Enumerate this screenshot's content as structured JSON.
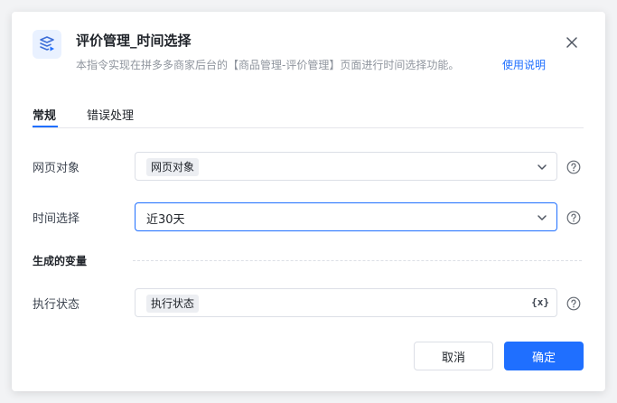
{
  "header": {
    "title": "评价管理_时间选择",
    "description": "本指令实现在拼多多商家后台的【商品管理-评价管理】页面进行时间选择功能。",
    "help_link": "使用说明"
  },
  "tabs": [
    {
      "label": "常规",
      "active": true
    },
    {
      "label": "错误处理",
      "active": false
    }
  ],
  "fields": {
    "page_object": {
      "label": "网页对象",
      "value": "网页对象"
    },
    "time_select": {
      "label": "时间选择",
      "value": "近30天"
    }
  },
  "output_section": {
    "title": "生成的变量",
    "exec_status": {
      "label": "执行状态",
      "value": "执行状态",
      "var_icon": "{x}"
    }
  },
  "footer": {
    "cancel_label": "取消",
    "ok_label": "确定"
  },
  "colors": {
    "accent": "#1f6fff",
    "icon_bg": "#e9f1ff"
  }
}
